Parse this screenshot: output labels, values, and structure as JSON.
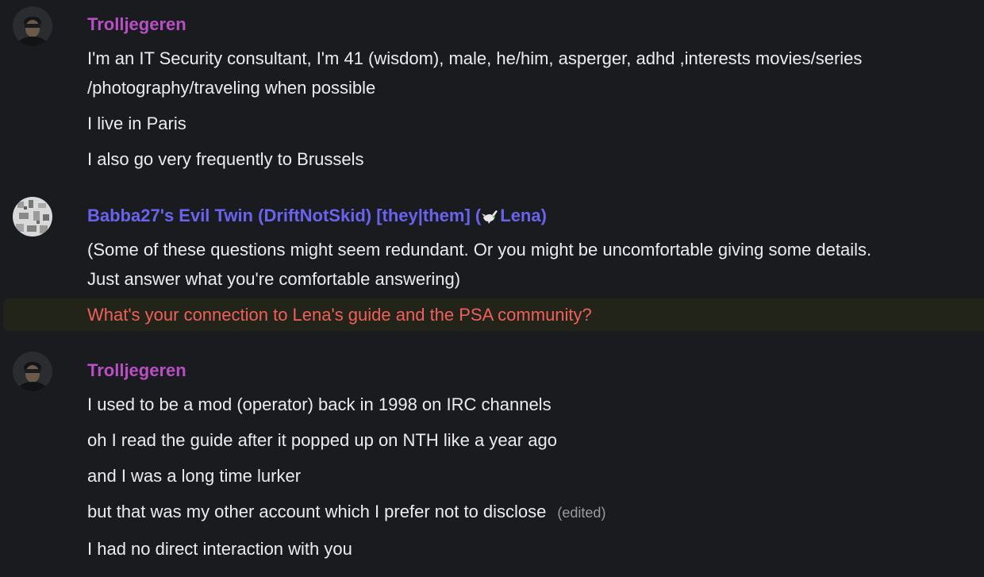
{
  "colors": {
    "background": "#1a1b1e",
    "text": "#ececee",
    "author_troll": "#b84fc4",
    "author_babba": "#6a63f0",
    "highlight_text": "#f0605a",
    "highlight_bg": "#232419",
    "muted": "#9a9aa0"
  },
  "messages": [
    {
      "author": "Trolljegeren",
      "author_color": "#b84fc4",
      "avatar": "trolljegeren-avatar",
      "lines": [
        "I'm an IT Security consultant, I'm 41 (wisdom), male, he/him, asperger, adhd ,interests movies/series",
        "/photography/traveling when possible",
        "I live in Paris",
        "I also go very frequently to Brussels"
      ]
    },
    {
      "author_prefix": "Babba27's Evil Twin (DriftNotSkid) [they|them] (",
      "author_suffix": "Lena)",
      "author_color": "#6a63f0",
      "avatar": "babba-avatar",
      "lines": [
        "(Some of these questions might seem redundant. Or you might be uncomfortable giving some details.",
        "Just answer what you're comfortable answering)"
      ],
      "highlighted_line": "What's your connection to Lena's guide and the PSA community?"
    },
    {
      "author": "Trolljegeren",
      "author_color": "#b84fc4",
      "avatar": "trolljegeren-avatar",
      "lines": [
        "I used to be a mod (operator) back in 1998 on IRC channels",
        "oh I read the guide after it popped up on NTH like a year ago",
        "and I was a long time lurker",
        "but that was my other account which I prefer not to disclose",
        "I had no direct interaction with you"
      ],
      "edited_label": "(edited)"
    }
  ]
}
